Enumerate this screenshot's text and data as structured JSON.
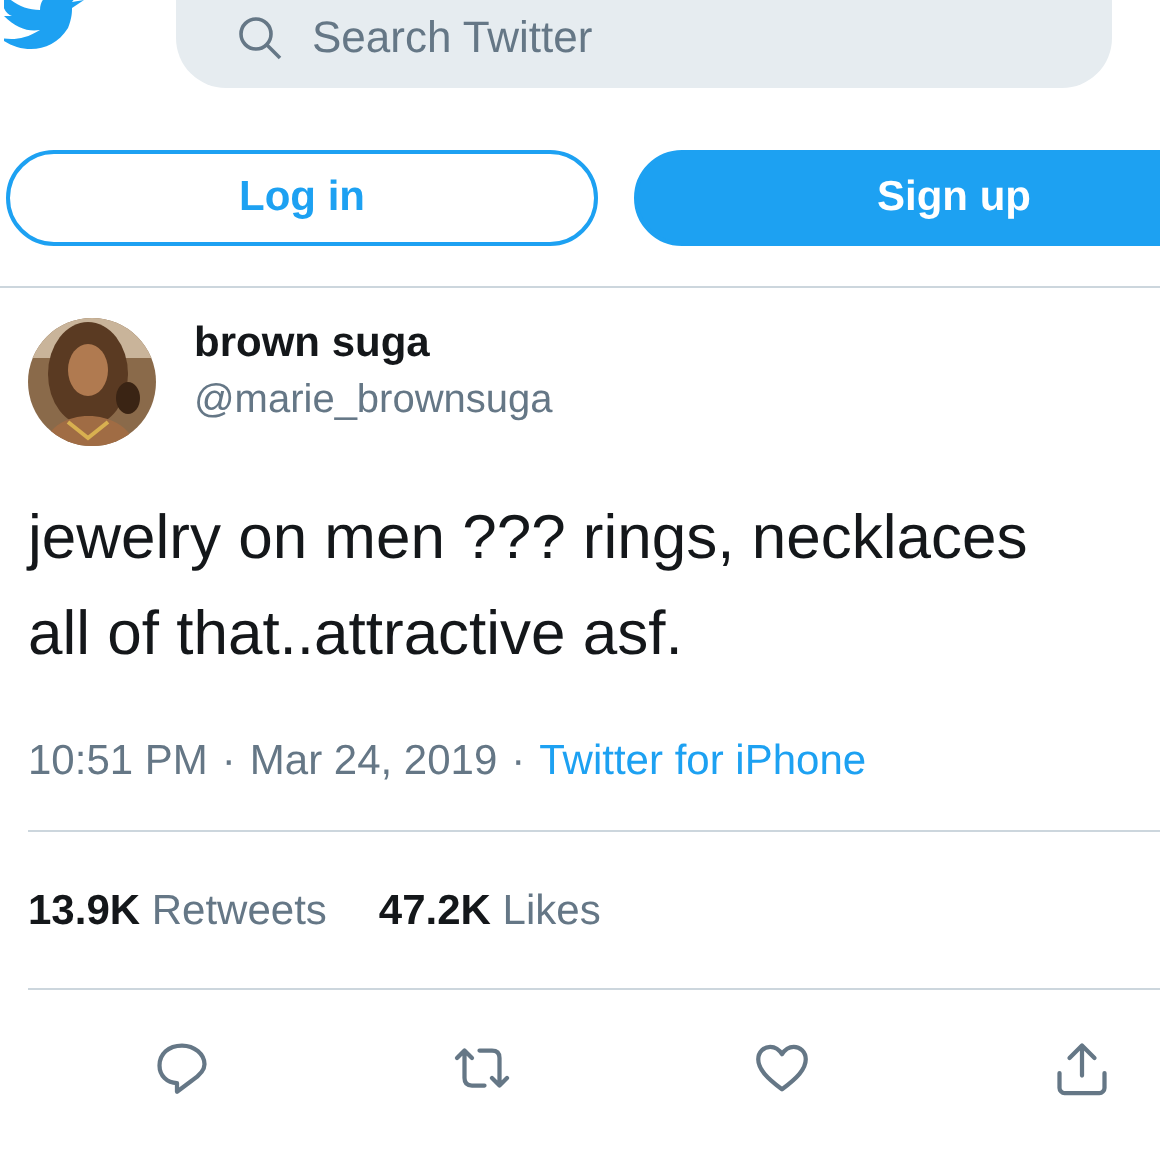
{
  "header": {
    "search": {
      "placeholder": "Search Twitter"
    }
  },
  "auth_buttons": [
    {
      "label": "Log in",
      "kind": "outline"
    },
    {
      "label": "Sign up",
      "kind": "filled"
    }
  ],
  "tweet": {
    "author": {
      "name": "brown suga",
      "handle": "@marie_brownsuga"
    },
    "text": "jewelry on men ??? rings, necklaces all of that..attractive asf.",
    "time": "10:51 PM",
    "separator": "·",
    "date": "Mar 24, 2019",
    "source": "Twitter for iPhone",
    "stats": [
      {
        "count": "13.9K",
        "label": "Retweets"
      },
      {
        "count": "47.2K",
        "label": "Likes"
      }
    ],
    "actions": [
      {
        "kind": "reply"
      },
      {
        "kind": "retweet"
      },
      {
        "kind": "like"
      },
      {
        "kind": "share"
      }
    ]
  }
}
